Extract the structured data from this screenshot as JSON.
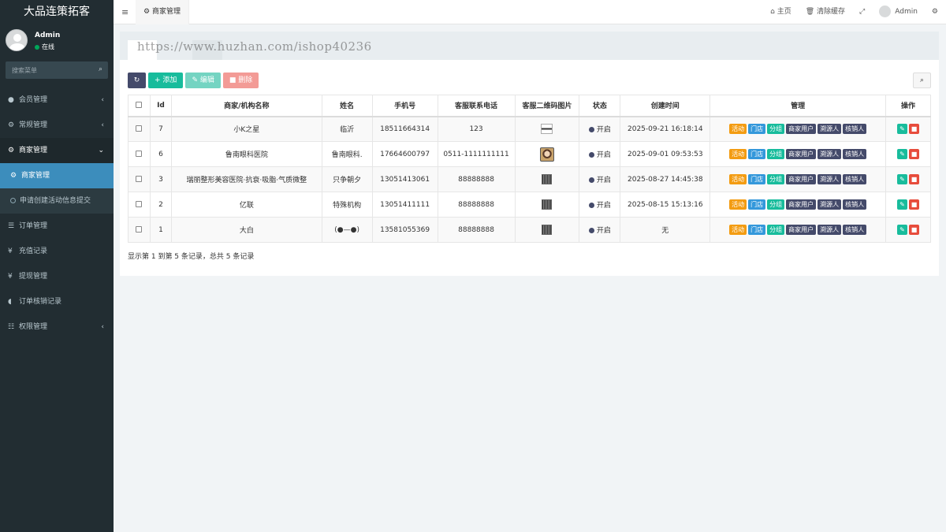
{
  "app": {
    "title": "大品连策拓客"
  },
  "user": {
    "name": "Admin",
    "status": "在线"
  },
  "sidebar": {
    "search_placeholder": "搜索菜单",
    "items": [
      {
        "label": "会员管理",
        "icon": "user-circle-icon"
      },
      {
        "label": "常规管理",
        "icon": "cogs-icon"
      },
      {
        "label": "商家管理",
        "icon": "gear-icon"
      },
      {
        "label": "订单管理",
        "icon": "list-icon"
      },
      {
        "label": "充值记录",
        "icon": "yen-icon"
      },
      {
        "label": "提现管理",
        "icon": "yen-icon"
      },
      {
        "label": "订单核销记录",
        "icon": "shield-icon"
      },
      {
        "label": "权限管理",
        "icon": "group-icon"
      }
    ],
    "submenu": [
      {
        "label": "商家管理"
      },
      {
        "label": "申请创建活动信息提交"
      }
    ]
  },
  "header": {
    "tab": "商家管理",
    "home": "主页",
    "clear_cache": "清除缓存",
    "user": "Admin"
  },
  "content": {
    "watermark": "https://www.huzhan.com/ishop40236",
    "toolbar": {
      "add": "添加",
      "edit": "编辑",
      "delete": "删除"
    },
    "table": {
      "headers": [
        "Id",
        "商家/机构名称",
        "姓名",
        "手机号",
        "客服联系电话",
        "客服二维码图片",
        "状态",
        "创建时间",
        "管理",
        "操作"
      ],
      "rows": [
        {
          "id": "7",
          "name": "小K之星",
          "person": "临沂",
          "phone": "18511664314",
          "service": "123",
          "status": "开启",
          "created": "2025-09-21 16:18:14"
        },
        {
          "id": "6",
          "name": "鲁南眼科医院",
          "person": "鲁南眼科.",
          "phone": "17664600797",
          "service": "0511-1111111111",
          "status": "开启",
          "created": "2025-09-01 09:53:53"
        },
        {
          "id": "3",
          "name": "瑞丽整形美容医院·抗衰·吸脂·气质微整",
          "person": "只争朝夕",
          "phone": "13051413061",
          "service": "88888888",
          "status": "开启",
          "created": "2025-08-27 14:45:38"
        },
        {
          "id": "2",
          "name": "亿联",
          "person": "特殊机构",
          "phone": "13051411111",
          "service": "88888888",
          "status": "开启",
          "created": "2025-08-15 15:13:16"
        },
        {
          "id": "1",
          "name": "大白",
          "person": "(●—●)",
          "phone": "13581055369",
          "service": "88888888",
          "status": "开启",
          "created": "无"
        }
      ],
      "manage_buttons": [
        "活动",
        "门店",
        "分组",
        "商家用户",
        "溯源人",
        "核销人"
      ]
    },
    "pager": "显示第 1 到第 5 条记录，总共 5 条记录"
  }
}
